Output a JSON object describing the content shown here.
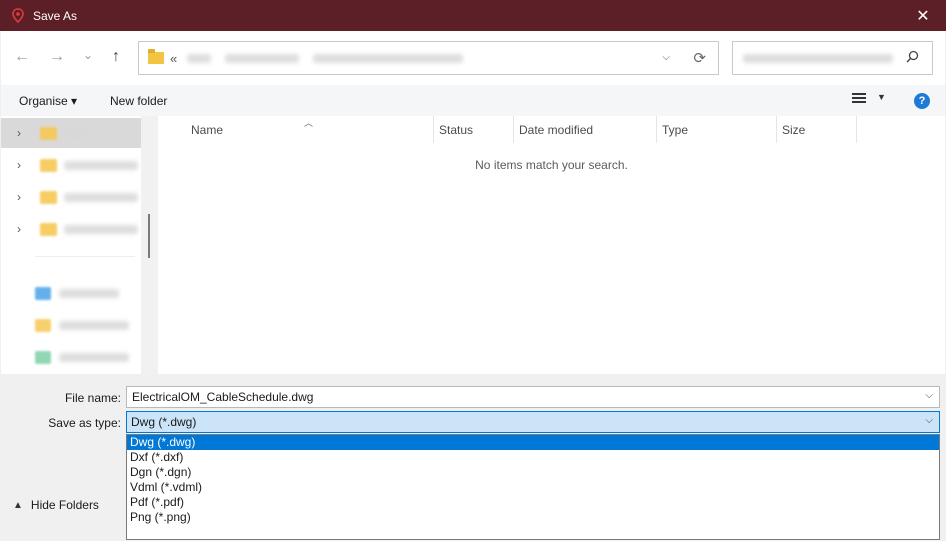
{
  "window": {
    "title": "Save As",
    "close_glyph": "✕",
    "accent_color": "#5c1f27"
  },
  "nav": {
    "back_glyph": "←",
    "forward_glyph": "→",
    "recent_glyph": "⌄",
    "up_glyph": "↑",
    "address_prefix": "«",
    "refresh_glyph": "⟳"
  },
  "toolbar": {
    "organise_label": "Organise ▾",
    "new_folder_label": "New folder",
    "help_label": "?"
  },
  "columns": [
    {
      "label": "Name"
    },
    {
      "label": "Status"
    },
    {
      "label": "Date modified"
    },
    {
      "label": "Type"
    },
    {
      "label": "Size"
    }
  ],
  "file_list": {
    "empty_message": "No items match your search."
  },
  "form": {
    "file_name_label": "File name:",
    "file_name_value": "ElectricalOM_CableSchedule.dwg",
    "save_as_type_label": "Save as type:",
    "save_as_type_value": "Dwg (*.dwg)",
    "hide_folders_label": "Hide Folders"
  },
  "type_options": [
    {
      "label": "Dwg (*.dwg)",
      "selected": true
    },
    {
      "label": "Dxf (*.dxf)"
    },
    {
      "label": "Dgn (*.dgn)"
    },
    {
      "label": "Vdml (*.vdml)"
    },
    {
      "label": "Pdf (*.pdf)"
    },
    {
      "label": "Png (*.png)"
    }
  ]
}
